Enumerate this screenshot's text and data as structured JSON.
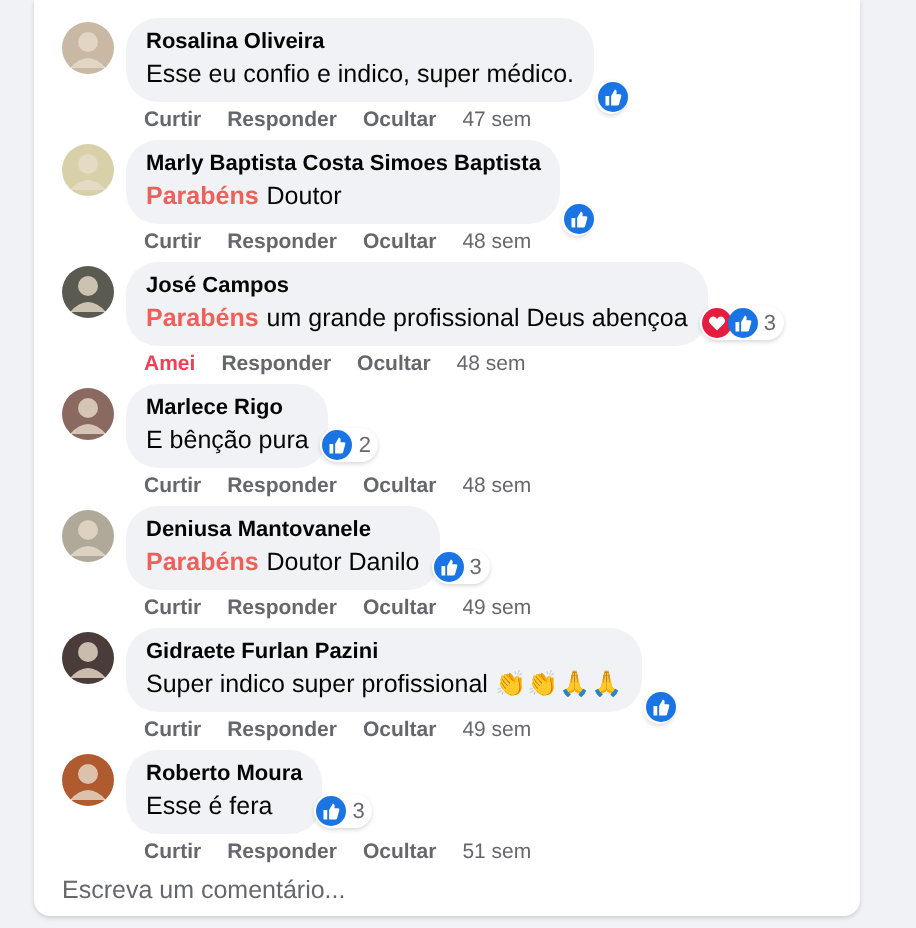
{
  "comments": [
    {
      "author": "Rosalina Oliveira",
      "text": "Esse eu confio e indico, super médico.",
      "reactions": [
        {
          "kind": "like"
        }
      ],
      "actions": [
        {
          "label": "Curtir",
          "active": false
        },
        {
          "label": "Responder",
          "active": false
        },
        {
          "label": "Ocultar",
          "active": false
        }
      ],
      "time": "47 sem"
    },
    {
      "author": "Marly Baptista Costa Simoes Baptista",
      "highlight": "Parabéns",
      "text": "Doutor",
      "reactions": [
        {
          "kind": "like"
        }
      ],
      "actions": [
        {
          "label": "Curtir",
          "active": false
        },
        {
          "label": "Responder",
          "active": false
        },
        {
          "label": "Ocultar",
          "active": false
        }
      ],
      "time": "48 sem"
    },
    {
      "author": "José Campos",
      "highlight": "Parabéns",
      "text": "um grande profissional Deus abençoa",
      "reactions": [
        {
          "kind": "love"
        },
        {
          "kind": "like"
        }
      ],
      "count": "3",
      "actions": [
        {
          "label": "Amei",
          "active": true
        },
        {
          "label": "Responder",
          "active": false
        },
        {
          "label": "Ocultar",
          "active": false
        }
      ],
      "time": "48 sem"
    },
    {
      "author": "Marlece Rigo",
      "text": "E bênção pura",
      "reactions": [
        {
          "kind": "like"
        }
      ],
      "count": "2",
      "actions": [
        {
          "label": "Curtir",
          "active": false
        },
        {
          "label": "Responder",
          "active": false
        },
        {
          "label": "Ocultar",
          "active": false
        }
      ],
      "time": "48 sem"
    },
    {
      "author": "Deniusa Mantovanele",
      "highlight": "Parabéns",
      "text": "Doutor Danilo",
      "reactions": [
        {
          "kind": "like"
        }
      ],
      "count": "3",
      "actions": [
        {
          "label": "Curtir",
          "active": false
        },
        {
          "label": "Responder",
          "active": false
        },
        {
          "label": "Ocultar",
          "active": false
        }
      ],
      "time": "49 sem"
    },
    {
      "author": "Gidraete Furlan Pazini",
      "text": "Super indico super profissional 👏👏🙏🙏",
      "reactions": [
        {
          "kind": "like"
        }
      ],
      "actions": [
        {
          "label": "Curtir",
          "active": false
        },
        {
          "label": "Responder",
          "active": false
        },
        {
          "label": "Ocultar",
          "active": false
        }
      ],
      "time": "49 sem"
    },
    {
      "author": "Roberto Moura",
      "text": "Esse é fera",
      "reactions": [
        {
          "kind": "like"
        }
      ],
      "count": "3",
      "actions": [
        {
          "label": "Curtir",
          "active": false
        },
        {
          "label": "Responder",
          "active": false
        },
        {
          "label": "Ocultar",
          "active": false
        }
      ],
      "time": "51 sem"
    }
  ],
  "composer": {
    "placeholder": "Escreva um comentário..."
  }
}
